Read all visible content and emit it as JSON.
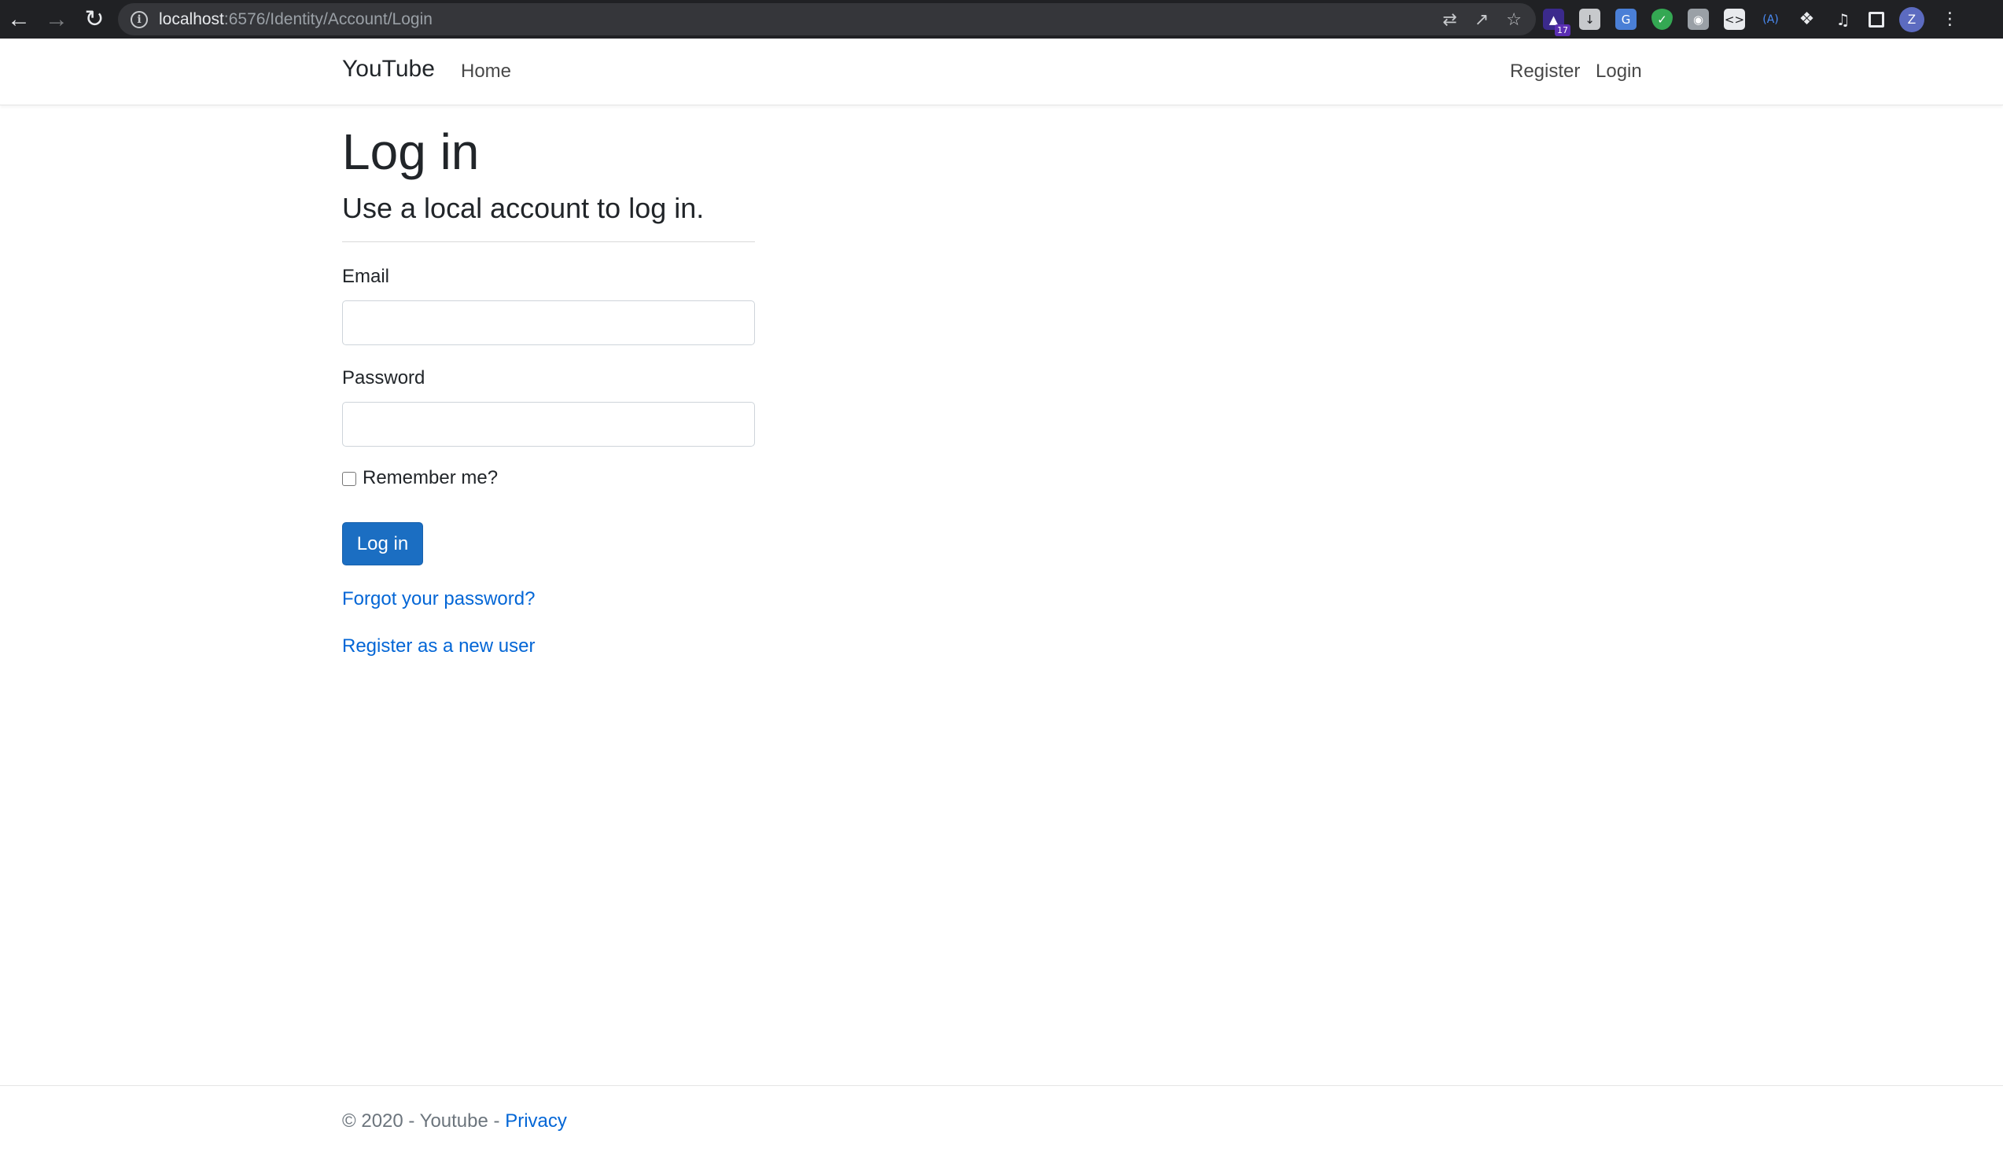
{
  "browser": {
    "url_host": "localhost",
    "url_path": ":6576/Identity/Account/Login",
    "extension_badge": "17",
    "profile_initial": "Z"
  },
  "navbar": {
    "brand": "YouTube",
    "home": "Home",
    "register": "Register",
    "login": "Login"
  },
  "login_form": {
    "title": "Log in",
    "subtitle": "Use a local account to log in.",
    "email_label": "Email",
    "email_value": "",
    "password_label": "Password",
    "password_value": "",
    "remember_label": "Remember me?",
    "remember_checked": false,
    "submit_label": "Log in",
    "forgot_link": "Forgot your password?",
    "register_link": "Register as a new user"
  },
  "footer": {
    "copyright": "© 2020 - Youtube - ",
    "privacy": "Privacy"
  },
  "colors": {
    "primary_button": "#1b6ec2",
    "link": "#0366d6",
    "chrome_bg": "#202124"
  }
}
